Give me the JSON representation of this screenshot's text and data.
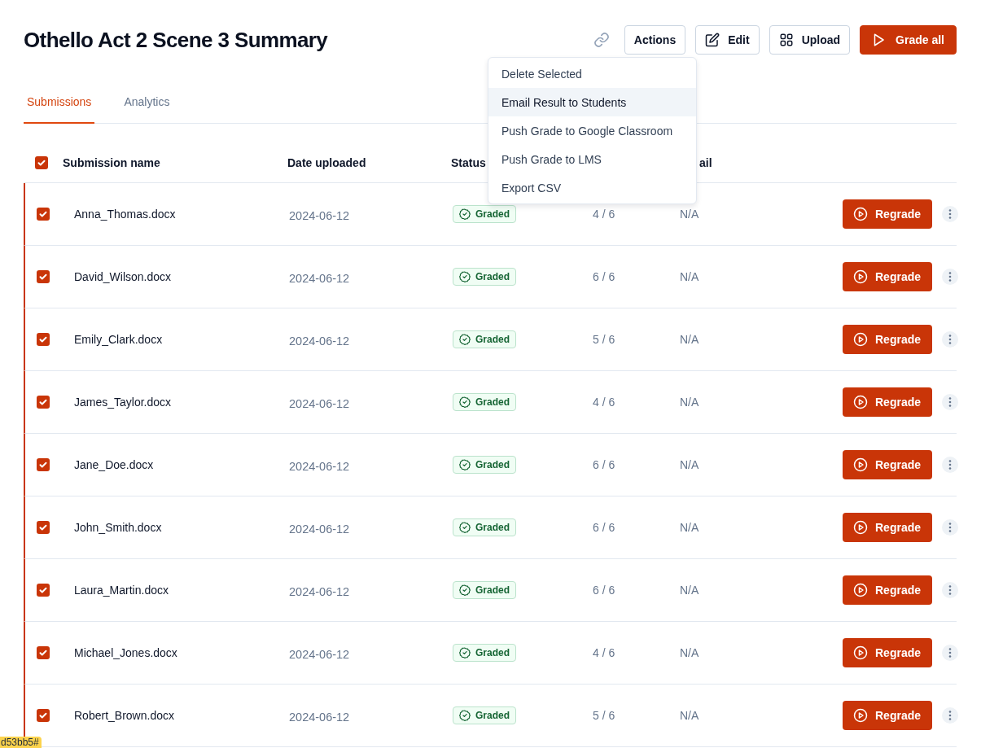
{
  "title": "Othello Act 2 Scene 3 Summary",
  "toolbar": {
    "buttons": [
      {
        "kind": "link"
      },
      {
        "kind": "outline",
        "label": "Actions"
      },
      {
        "kind": "edit",
        "label": "Edit"
      },
      {
        "kind": "upload",
        "label": "Upload"
      },
      {
        "kind": "primary",
        "label": "Grade all"
      }
    ]
  },
  "actions_menu": {
    "items": [
      {
        "label": "Delete Selected",
        "selected": false
      },
      {
        "label": "Email Result to Students",
        "selected": true
      },
      {
        "label": "Push Grade to Google Classroom",
        "selected": false
      },
      {
        "label": "Push Grade to LMS",
        "selected": false
      },
      {
        "label": "Export CSV",
        "selected": false
      }
    ]
  },
  "tabs": [
    {
      "label": "Submissions",
      "selected": true
    },
    {
      "label": "Analytics",
      "selected": false
    }
  ],
  "table": {
    "all_checked": true,
    "columns": [
      "Submission name",
      "Date uploaded",
      "Status",
      "",
      "ail"
    ],
    "rows": [
      {
        "checked": true,
        "name": "Anna_Thomas.docx",
        "date": "2024-06-12",
        "status": "Graded",
        "score": "4 / 6",
        "email": "N/A",
        "action": "Regrade"
      },
      {
        "checked": true,
        "name": "David_Wilson.docx",
        "date": "2024-06-12",
        "status": "Graded",
        "score": "6 / 6",
        "email": "N/A",
        "action": "Regrade"
      },
      {
        "checked": true,
        "name": "Emily_Clark.docx",
        "date": "2024-06-12",
        "status": "Graded",
        "score": "5 / 6",
        "email": "N/A",
        "action": "Regrade"
      },
      {
        "checked": true,
        "name": "James_Taylor.docx",
        "date": "2024-06-12",
        "status": "Graded",
        "score": "4 / 6",
        "email": "N/A",
        "action": "Regrade"
      },
      {
        "checked": true,
        "name": "Jane_Doe.docx",
        "date": "2024-06-12",
        "status": "Graded",
        "score": "6 / 6",
        "email": "N/A",
        "action": "Regrade"
      },
      {
        "checked": true,
        "name": "John_Smith.docx",
        "date": "2024-06-12",
        "status": "Graded",
        "score": "6 / 6",
        "email": "N/A",
        "action": "Regrade"
      },
      {
        "checked": true,
        "name": "Laura_Martin.docx",
        "date": "2024-06-12",
        "status": "Graded",
        "score": "6 / 6",
        "email": "N/A",
        "action": "Regrade"
      },
      {
        "checked": true,
        "name": "Michael_Jones.docx",
        "date": "2024-06-12",
        "status": "Graded",
        "score": "4 / 6",
        "email": "N/A",
        "action": "Regrade"
      },
      {
        "checked": true,
        "name": "Robert_Brown.docx",
        "date": "2024-06-12",
        "status": "Graded",
        "score": "5 / 6",
        "email": "N/A",
        "action": "Regrade"
      }
    ]
  },
  "corner_tag": "d53bb5#"
}
